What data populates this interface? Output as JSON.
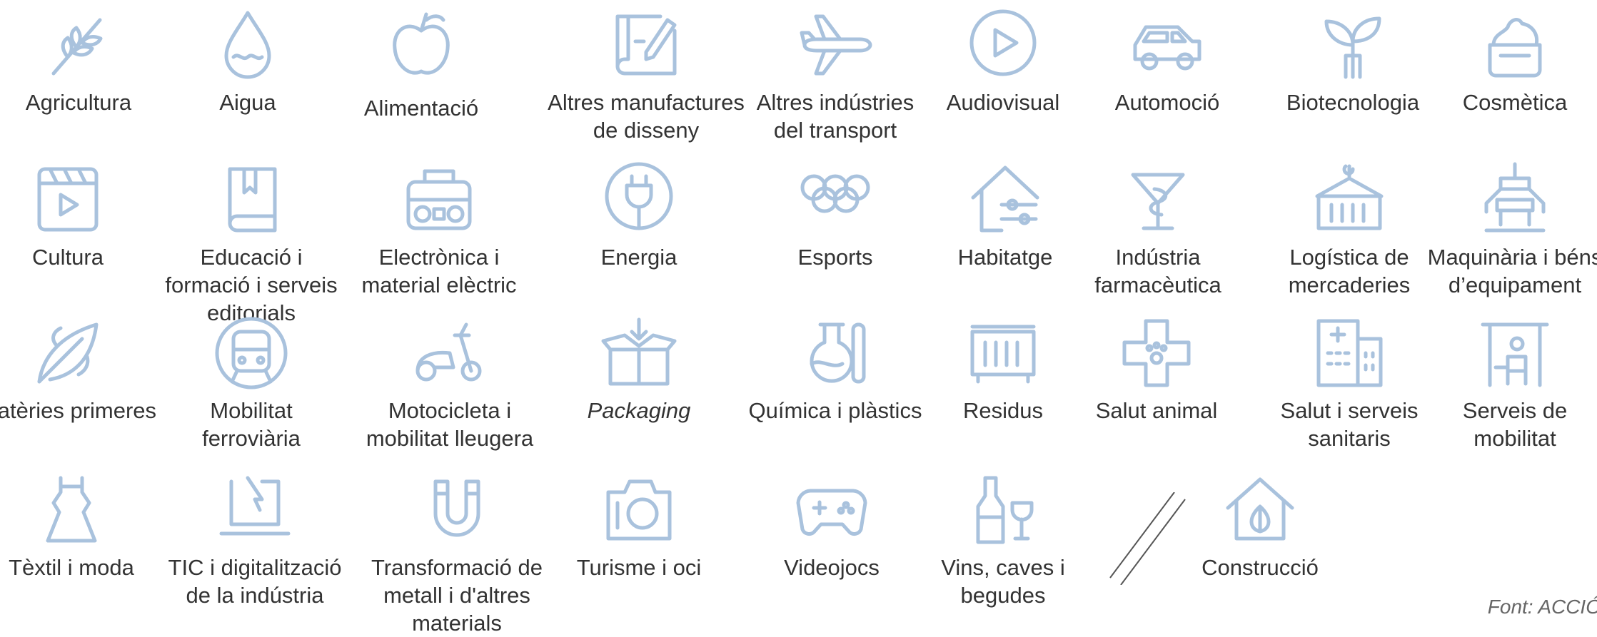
{
  "sectors": [
    {
      "label": "Agricultura",
      "icon": "wheat-icon"
    },
    {
      "label": "Aigua",
      "icon": "water-drop-icon"
    },
    {
      "label": "Alimentació",
      "icon": "apple-icon"
    },
    {
      "label": "Altres manufactures de disseny",
      "icon": "blueprint-pencil-icon"
    },
    {
      "label": "Altres indústries del transport",
      "icon": "airplane-icon"
    },
    {
      "label": "Audiovisual",
      "icon": "play-circle-icon"
    },
    {
      "label": "Automoció",
      "icon": "car-icon"
    },
    {
      "label": "Biotecnologia",
      "icon": "sprout-icon"
    },
    {
      "label": "Cosmètica",
      "icon": "cream-jar-icon"
    },
    {
      "label": "Cultura",
      "icon": "clapperboard-icon"
    },
    {
      "label": "Educació i formació i serveis editorials",
      "icon": "book-icon"
    },
    {
      "label": "Electrònica i material elèctric",
      "icon": "radio-icon"
    },
    {
      "label": "Energia",
      "icon": "plug-icon"
    },
    {
      "label": "Esports",
      "icon": "olympic-rings-icon"
    },
    {
      "label": "Habitatge",
      "icon": "house-settings-icon"
    },
    {
      "label": "Indústria farmacèutica",
      "icon": "pharmacy-cup-icon"
    },
    {
      "label": "Logística de mercaderies",
      "icon": "container-icon"
    },
    {
      "label": "Maquinària i béns d’equipament",
      "icon": "crane-claw-icon"
    },
    {
      "label": "Matèries primeres",
      "icon": "leaf-icon"
    },
    {
      "label": "Mobilitat ferroviària",
      "icon": "train-icon"
    },
    {
      "label": "Motocicleta i mobilitat lleugera",
      "icon": "scooter-icon"
    },
    {
      "label": "Packaging",
      "icon": "box-icon",
      "italic": true
    },
    {
      "label": "Química i plàstics",
      "icon": "flask-icon"
    },
    {
      "label": "Residus",
      "icon": "waste-container-icon"
    },
    {
      "label": "Salut animal",
      "icon": "paw-cross-icon"
    },
    {
      "label": "Salut i serveis sanitaris",
      "icon": "hospital-icon"
    },
    {
      "label": "Serveis de mobilitat",
      "icon": "bus-stop-icon"
    },
    {
      "label": "Tèxtil i moda",
      "icon": "dress-icon"
    },
    {
      "label": "TIC i digitalització de la indústria",
      "icon": "laptop-cursor-icon"
    },
    {
      "label": "Transformació de metall i d'altres materials",
      "icon": "magnet-icon"
    },
    {
      "label": "Turisme i oci",
      "icon": "camera-icon"
    },
    {
      "label": "Videojocs",
      "icon": "gamepad-icon"
    },
    {
      "label": "Vins, caves i begudes",
      "icon": "bottle-glass-icon"
    },
    {
      "label": "Construcció",
      "icon": "eco-house-icon"
    }
  ],
  "source": "Font: ACCIÓ",
  "colors": {
    "icon_stroke": "#a9c2dd",
    "text": "#333333"
  }
}
